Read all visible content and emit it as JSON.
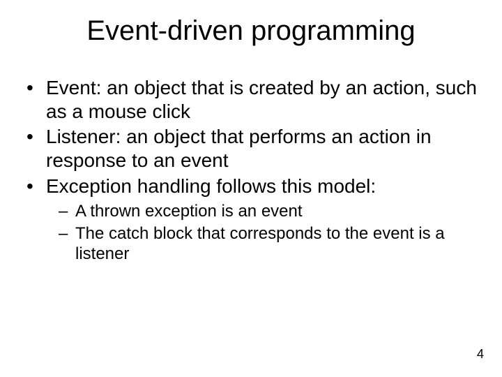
{
  "title": "Event-driven programming",
  "bullets": [
    "Event: an object that is created by an action, such as a mouse click",
    "Listener: an object that performs an action in response to an event",
    "Exception handling follows this model:"
  ],
  "subbullets": [
    "A thrown exception is an event",
    "The catch block that corresponds to the event is a listener"
  ],
  "page_number": "4"
}
